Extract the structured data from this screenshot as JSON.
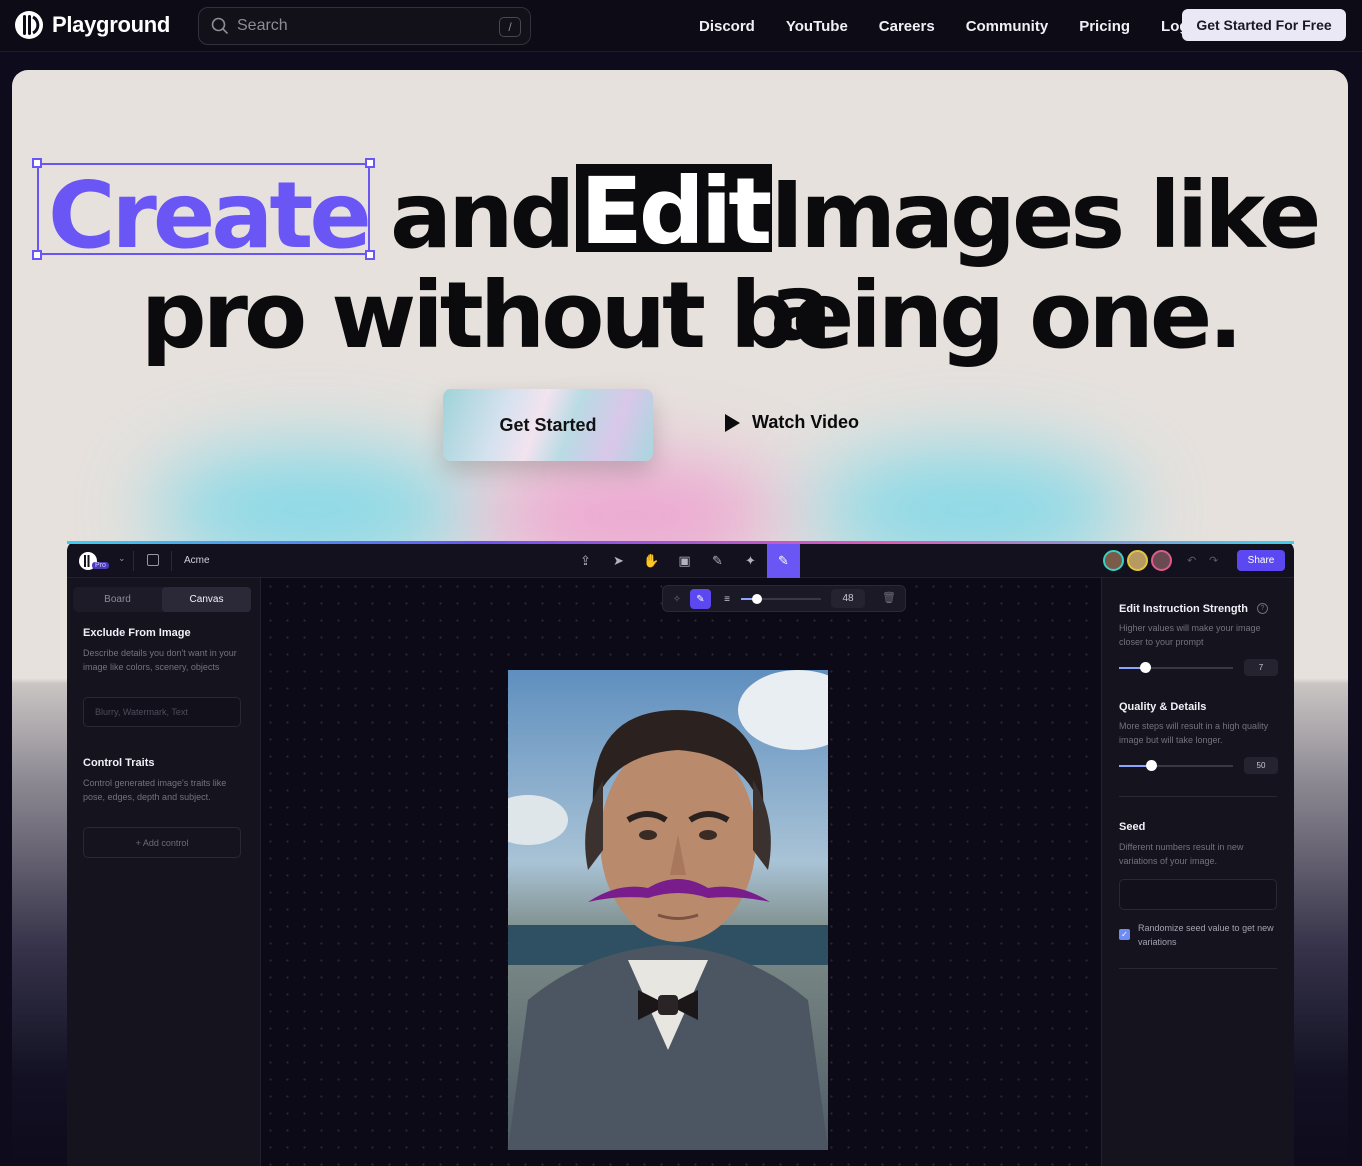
{
  "nav": {
    "brand": "Playground",
    "search_placeholder": "Search",
    "search_shortcut": "/",
    "links": [
      "Discord",
      "YouTube",
      "Careers",
      "Community",
      "Pricing",
      "Log in"
    ],
    "cta": "Get Started For Free"
  },
  "hero": {
    "word_create": "Create",
    "word_and": "and",
    "word_edit": "Edit",
    "words_rest_line1": "Images like a",
    "line2": "pro without being one.",
    "cta": "Get Started",
    "watch": "Watch Video"
  },
  "app": {
    "badge": "Pro",
    "project": "Acme",
    "share": "Share",
    "tabs": [
      "Board",
      "Canvas"
    ],
    "active_tab": "Canvas",
    "exclude": {
      "title": "Exclude From Image",
      "desc": "Describe details you don't want in your image like colors, scenery, objects",
      "placeholder": "Blurry, Watermark, Text"
    },
    "control": {
      "title": "Control Traits",
      "desc": "Control generated image's traits like pose, edges, depth and subject.",
      "add": "+ Add control"
    },
    "brush": {
      "size": "48",
      "level": 0.2
    },
    "right": {
      "strength": {
        "title": "Edit Instruction Strength",
        "desc": "Higher values will make your image closer to your prompt",
        "value": "7",
        "level": 0.23
      },
      "quality": {
        "title": "Quality & Details",
        "desc": "More steps will result in a high quality image but will take longer.",
        "value": "50",
        "level": 0.28
      },
      "seed": {
        "title": "Seed",
        "desc": "Different numbers result in new variations of your image.",
        "value": ""
      },
      "randomize": {
        "label": "Randomize seed value to get new variations",
        "checked": true
      }
    },
    "accent": "#6a55f5"
  }
}
